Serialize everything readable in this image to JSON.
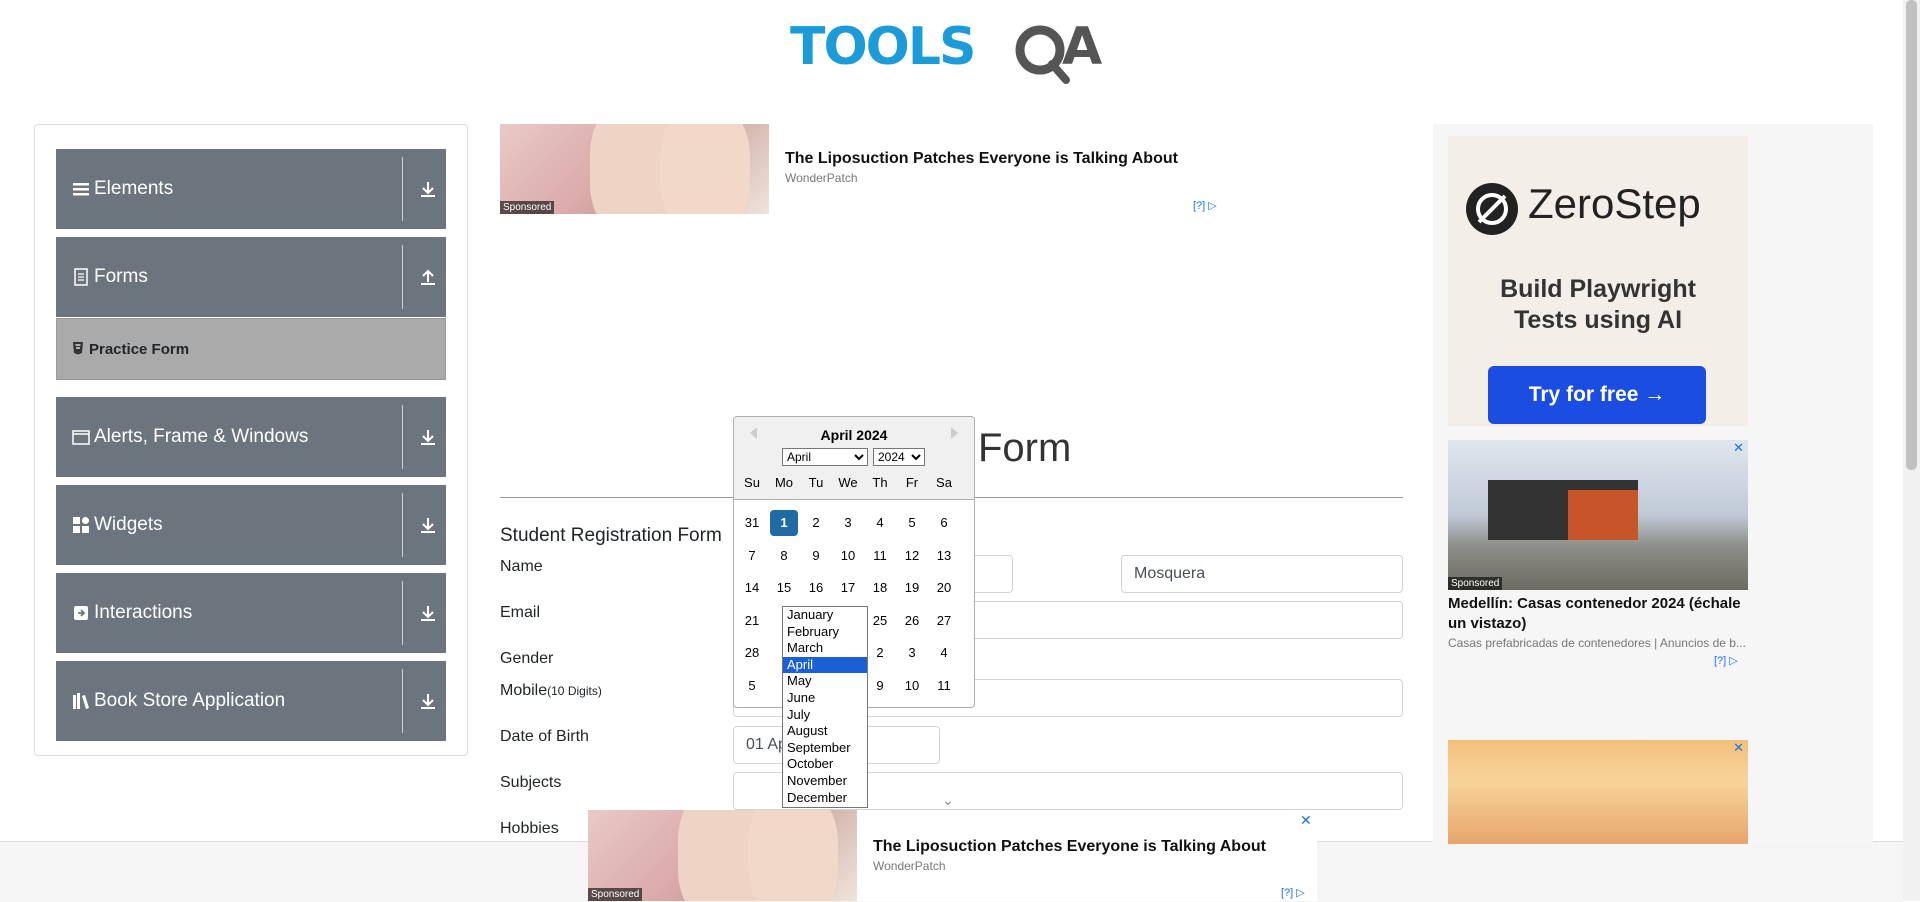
{
  "logo": {
    "text": "TOOLSQA"
  },
  "sidebar": {
    "groups": [
      {
        "label": "Elements",
        "icon": "menu-icon",
        "arrow": "download-icon"
      },
      {
        "label": "Forms",
        "icon": "document-icon",
        "arrow": "upload-icon"
      },
      {
        "label": "Alerts, Frame & Windows",
        "icon": "window-icon",
        "arrow": "download-icon"
      },
      {
        "label": "Widgets",
        "icon": "widgets-icon",
        "arrow": "download-icon"
      },
      {
        "label": "Interactions",
        "icon": "interaction-icon",
        "arrow": "download-icon"
      },
      {
        "label": "Book Store Application",
        "icon": "books-icon",
        "arrow": "download-icon"
      }
    ],
    "active_item": "Practice Form"
  },
  "top_ad": {
    "title": "The Liposuction Patches Everyone is Talking About",
    "source": "WonderPatch",
    "sponsored": "Sponsored",
    "choices": "[?]"
  },
  "bottom_ad": {
    "title": "The Liposuction Patches Everyone is Talking About",
    "source": "WonderPatch",
    "sponsored": "Sponsored",
    "choices": "[?]"
  },
  "form": {
    "page_title_visible": "Form",
    "section_title": "Student Registration Form",
    "labels": {
      "name": "Name",
      "email": "Email",
      "gender": "Gender",
      "mobile": "Mobile",
      "mobile_hint": "(10 Digits)",
      "dob": "Date of Birth",
      "subjects": "Subjects",
      "hobbies": "Hobbies"
    },
    "last_name_value": "Mosquera",
    "dob_value": "01 Ap"
  },
  "datepicker": {
    "header": "April 2024",
    "month_select": "April",
    "year_select": "2024",
    "day_names": [
      "Su",
      "Mo",
      "Tu",
      "We",
      "Th",
      "Fr",
      "Sa"
    ],
    "weeks": [
      [
        "31",
        "1",
        "2",
        "3",
        "4",
        "5",
        "6"
      ],
      [
        "7",
        "8",
        "9",
        "10",
        "11",
        "12",
        "13"
      ],
      [
        "14",
        "15",
        "16",
        "17",
        "18",
        "19",
        "20"
      ],
      [
        "21",
        "",
        "",
        "",
        "25",
        "26",
        "27"
      ],
      [
        "28",
        "",
        "",
        "",
        "2",
        "3",
        "4"
      ],
      [
        "5",
        "",
        "",
        "",
        "9",
        "10",
        "11"
      ]
    ],
    "selected_day": "1",
    "months": [
      "January",
      "February",
      "March",
      "April",
      "May",
      "June",
      "July",
      "August",
      "September",
      "October",
      "November",
      "December"
    ],
    "highlighted_month": "April"
  },
  "right_ad": {
    "brand": "ZeroStep",
    "headline": "Build Playwright Tests using AI",
    "cta": "Try for free →",
    "card_title": "Medellín: Casas contenedor 2024 (échale un vistazo)",
    "card_source": "Casas prefabricadas de contenedores | Anuncios de b...",
    "sponsored": "Sponsored",
    "choices": "[?]",
    "close": "✕"
  },
  "colors": {
    "brand_blue": "#1b9bd7",
    "sidebar_gray": "#6c757d",
    "active_gray": "#aaaaaa",
    "dp_selected": "#216ba5",
    "cta_blue": "#1b4ee0"
  }
}
